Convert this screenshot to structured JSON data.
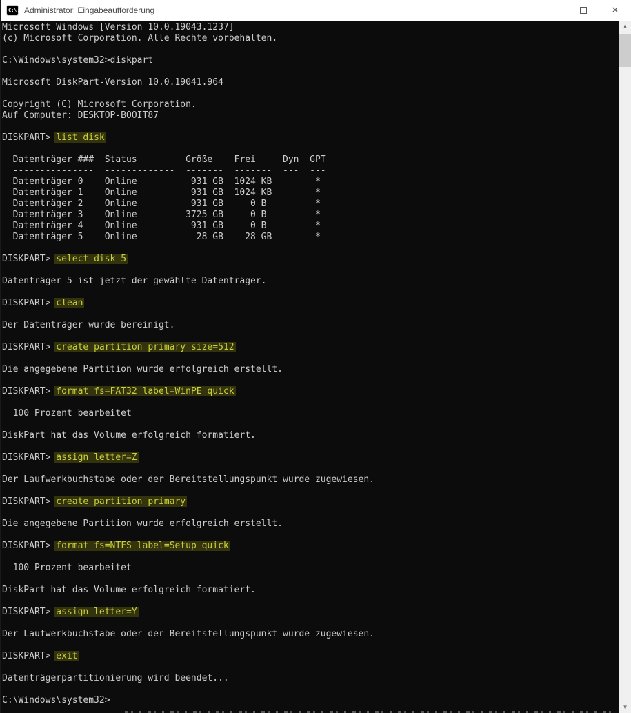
{
  "window": {
    "title": "Administrator: Eingabeaufforderung",
    "app_icon_glyph": "C:\\.",
    "controls": {
      "minimize": "—",
      "close": "✕"
    }
  },
  "colors": {
    "terminal_bg": "#0c0c0c",
    "terminal_fg": "#cccccc",
    "command_fg": "#c9cf3a",
    "command_bg": "#33330e",
    "titlebar_bg": "#ffffff",
    "titlebar_fg": "#4a4a4a",
    "scrollbar_track": "#f0f0f0",
    "scrollbar_thumb": "#cdcdcd"
  },
  "scrollbar": {
    "up_arrow": "∧",
    "down_arrow": "∨"
  },
  "terminal": {
    "lines": [
      {
        "s": [
          {
            "t": "Microsoft Windows [Version 10.0.19043.1237]"
          }
        ]
      },
      {
        "s": [
          {
            "t": "(c) Microsoft Corporation. Alle Rechte vorbehalten."
          }
        ]
      },
      {
        "s": []
      },
      {
        "s": [
          {
            "t": "C:\\Windows\\system32>diskpart"
          }
        ]
      },
      {
        "s": []
      },
      {
        "s": [
          {
            "t": "Microsoft DiskPart-Version 10.0.19041.964"
          }
        ]
      },
      {
        "s": []
      },
      {
        "s": [
          {
            "t": "Copyright (C) Microsoft Corporation."
          }
        ]
      },
      {
        "s": [
          {
            "t": "Auf Computer: DESKTOP-BOOIT87"
          }
        ]
      },
      {
        "s": []
      },
      {
        "s": [
          {
            "t": "DISKPART> "
          },
          {
            "t": "list disk",
            "hl": true
          }
        ]
      },
      {
        "s": []
      },
      {
        "s": [
          {
            "t": "  Datenträger ###  Status         Größe    Frei     Dyn  GPT"
          }
        ]
      },
      {
        "s": [
          {
            "t": "  ---------------  -------------  -------  -------  ---  ---"
          }
        ]
      },
      {
        "s": [
          {
            "t": "  Datenträger 0    Online          931 GB  1024 KB        *"
          }
        ]
      },
      {
        "s": [
          {
            "t": "  Datenträger 1    Online          931 GB  1024 KB        *"
          }
        ]
      },
      {
        "s": [
          {
            "t": "  Datenträger 2    Online          931 GB     0 B         *"
          }
        ]
      },
      {
        "s": [
          {
            "t": "  Datenträger 3    Online         3725 GB     0 B         *"
          }
        ]
      },
      {
        "s": [
          {
            "t": "  Datenträger 4    Online          931 GB     0 B         *"
          }
        ]
      },
      {
        "s": [
          {
            "t": "  Datenträger 5    Online           28 GB    28 GB        *"
          }
        ]
      },
      {
        "s": []
      },
      {
        "s": [
          {
            "t": "DISKPART> "
          },
          {
            "t": "select disk 5",
            "hl": true
          }
        ]
      },
      {
        "s": []
      },
      {
        "s": [
          {
            "t": "Datenträger 5 ist jetzt der gewählte Datenträger."
          }
        ]
      },
      {
        "s": []
      },
      {
        "s": [
          {
            "t": "DISKPART> "
          },
          {
            "t": "clean",
            "hl": true
          }
        ]
      },
      {
        "s": []
      },
      {
        "s": [
          {
            "t": "Der Datenträger wurde bereinigt."
          }
        ]
      },
      {
        "s": []
      },
      {
        "s": [
          {
            "t": "DISKPART> "
          },
          {
            "t": "create partition primary size=512",
            "hl": true
          }
        ]
      },
      {
        "s": []
      },
      {
        "s": [
          {
            "t": "Die angegebene Partition wurde erfolgreich erstellt."
          }
        ]
      },
      {
        "s": []
      },
      {
        "s": [
          {
            "t": "DISKPART> "
          },
          {
            "t": "format fs=FAT32 label=WinPE quick",
            "hl": true
          }
        ]
      },
      {
        "s": []
      },
      {
        "s": [
          {
            "t": "  100 Prozent bearbeitet"
          }
        ]
      },
      {
        "s": []
      },
      {
        "s": [
          {
            "t": "DiskPart hat das Volume erfolgreich formatiert."
          }
        ]
      },
      {
        "s": []
      },
      {
        "s": [
          {
            "t": "DISKPART> "
          },
          {
            "t": "assign letter=Z",
            "hl": true
          }
        ]
      },
      {
        "s": []
      },
      {
        "s": [
          {
            "t": "Der Laufwerkbuchstabe oder der Bereitstellungspunkt wurde zugewiesen."
          }
        ]
      },
      {
        "s": []
      },
      {
        "s": [
          {
            "t": "DISKPART> "
          },
          {
            "t": "create partition primary",
            "hl": true
          }
        ]
      },
      {
        "s": []
      },
      {
        "s": [
          {
            "t": "Die angegebene Partition wurde erfolgreich erstellt."
          }
        ]
      },
      {
        "s": []
      },
      {
        "s": [
          {
            "t": "DISKPART> "
          },
          {
            "t": "format fs=NTFS label=Setup quick",
            "hl": true
          }
        ]
      },
      {
        "s": []
      },
      {
        "s": [
          {
            "t": "  100 Prozent bearbeitet"
          }
        ]
      },
      {
        "s": []
      },
      {
        "s": [
          {
            "t": "DiskPart hat das Volume erfolgreich formatiert."
          }
        ]
      },
      {
        "s": []
      },
      {
        "s": [
          {
            "t": "DISKPART> "
          },
          {
            "t": "assign letter=Y",
            "hl": true
          }
        ]
      },
      {
        "s": []
      },
      {
        "s": [
          {
            "t": "Der Laufwerkbuchstabe oder der Bereitstellungspunkt wurde zugewiesen."
          }
        ]
      },
      {
        "s": []
      },
      {
        "s": [
          {
            "t": "DISKPART> "
          },
          {
            "t": "exit",
            "hl": true
          }
        ]
      },
      {
        "s": []
      },
      {
        "s": [
          {
            "t": "Datenträgerpartitionierung wird beendet..."
          }
        ]
      },
      {
        "s": []
      },
      {
        "s": [
          {
            "t": "C:\\Windows\\system32>"
          }
        ]
      }
    ]
  }
}
